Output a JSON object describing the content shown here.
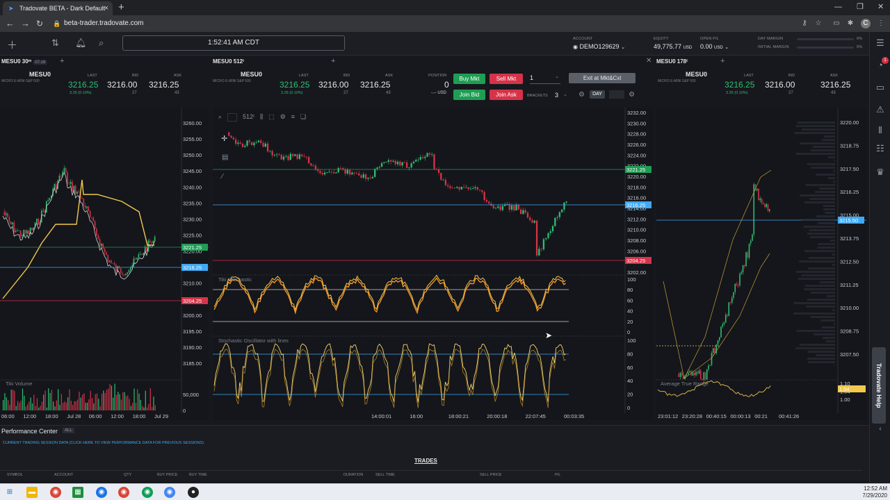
{
  "browser": {
    "tab_title": "Tradovate BETA - Dark Default",
    "url": "beta-trader.tradovate.com",
    "accent": "#4aa3ff"
  },
  "header": {
    "clock": "1:52:41 AM CDT",
    "account_label": "ACCOUNT",
    "account": "DEMO129629",
    "equity_label": "EQUITY",
    "equity": "49,775.77",
    "equity_ccy": "USD",
    "openpl_label": "OPEN P/L",
    "openpl": "0.00",
    "openpl_ccy": "USD",
    "day_margin_label": "DAY MARGIN",
    "initial_margin_label": "INITIAL MARGIN",
    "day_margin_pct": "0%",
    "initial_margin_pct": "0%"
  },
  "quote_headers": {
    "last": "LAST",
    "bid": "BID",
    "ask": "ASK",
    "position": "POSITION"
  },
  "panels": [
    {
      "tab": "MESU0 30ᵐ",
      "timer": "07:18",
      "symbol": "MESU0",
      "desc": "MICRO E-MINI S&P 500",
      "last": "3216.25",
      "change": "3.25 (0.10%)",
      "bid": "3216.00",
      "bid_size": "27",
      "ask": "3216.25",
      "ask_size": "43",
      "price_axis": [
        "3260.00",
        "3255.00",
        "3250.00",
        "3245.00",
        "3240.00",
        "3235.00",
        "3230.00",
        "3225.00",
        "3220.00",
        "3215.00",
        "3210.00",
        "3205.00",
        "3200.00",
        "3195.00",
        "3190.00",
        "3185.00"
      ],
      "price_tags": {
        "green": "3221.25",
        "blue": "3216.25",
        "red": "3204.25"
      },
      "volume_label": "Tiki Volume",
      "volume_axis": [
        "50,000",
        "0"
      ],
      "time_axis": [
        "06:00",
        "12:00",
        "18:00",
        "Jul 28",
        "06:00",
        "12:00",
        "18:00",
        "Jul 29"
      ]
    },
    {
      "tab": "MESU0 512ᵗ",
      "symbol": "MESU0",
      "desc": "MICRO E-MINI S&P 500",
      "last": "3216.25",
      "change": "3.25 (0.10%)",
      "bid": "3216.00",
      "bid_size": "27",
      "ask": "3216.25",
      "ask_size": "43",
      "position": "0",
      "position_ccy": "-.-- USD",
      "buy_mkt": "Buy Mkt",
      "sell_mkt": "Sell Mkt",
      "join_bid": "Join Bid",
      "join_ask": "Join Ask",
      "qty": "1",
      "brackets_label": "BRACKETS",
      "brackets": "3",
      "exit_label": "Exit at Mkt&Cxl",
      "tif": "DAY",
      "toolbar_tf": "512ᵗ",
      "price_axis": [
        "3232.00",
        "3230.00",
        "3228.00",
        "3226.00",
        "3224.00",
        "3222.00",
        "3220.00",
        "3218.00",
        "3216.00",
        "3214.00",
        "3212.00",
        "3210.00",
        "3208.00",
        "3206.00",
        "3204.00",
        "3202.00"
      ],
      "price_tags": {
        "green": "3221.25",
        "blue": "3216.25",
        "red": "3204.25"
      },
      "ind1_label": "Tiki Stochastic",
      "ind1_axis": [
        "100",
        "80",
        "60",
        "40",
        "20",
        "0"
      ],
      "ind2_label": "Stochastic Oscillator with lines",
      "ind2_axis": [
        "100",
        "80",
        "60",
        "40",
        "20",
        "0"
      ],
      "time_axis": [
        "14:00:01",
        "16:00",
        "18:00:21",
        "20:00:18",
        "22:07:45",
        "00:03:35"
      ]
    },
    {
      "tab": "MESU0 178ᵗ",
      "symbol": "MESU0",
      "desc": "MICRO E-MINI S&P 500",
      "last": "3216.25",
      "change": "3.25 (0.10%)",
      "bid": "3216.00",
      "bid_size": "27",
      "ask": "3216.25",
      "ask_size": "43",
      "price_axis": [
        "3220.00",
        "3218.75",
        "3217.50",
        "3216.25",
        "3215.00",
        "3213.75",
        "3212.50",
        "3211.25",
        "3210.00",
        "3208.75",
        "3207.50"
      ],
      "price_tag": "3215.50",
      "atr_label": "Average True Range",
      "atr_axis": [
        "1.10",
        "1.04",
        "1.00"
      ],
      "time_axis": [
        "23:01:12",
        "23:20:28",
        "00:40:15",
        "00:00:13",
        "00:21",
        "00:41:26"
      ]
    }
  ],
  "performance": {
    "title": "Performance Center",
    "badge": "ALL",
    "note": "CURRENT TRADING SESSION DATA (CLICK HERE TO VIEW PERFORMANCE DATA FOR PREVIOUS SESSIONS)",
    "trades_label": "TRADES",
    "columns": [
      "SYMBOL",
      "ACCOUNT",
      "QTY",
      "BUY PRICE",
      "BUY TIME",
      "DURATION",
      "SELL TIME",
      "SELL PRICE",
      "P/L"
    ]
  },
  "taskbar": {
    "time": "12:52 AM",
    "date": "7/29/2020"
  },
  "colors": {
    "green": "#1f9d55",
    "red": "#d6334a",
    "blue": "#3fa9f5",
    "yellow": "#f2c94c",
    "orange": "#f0932b"
  }
}
